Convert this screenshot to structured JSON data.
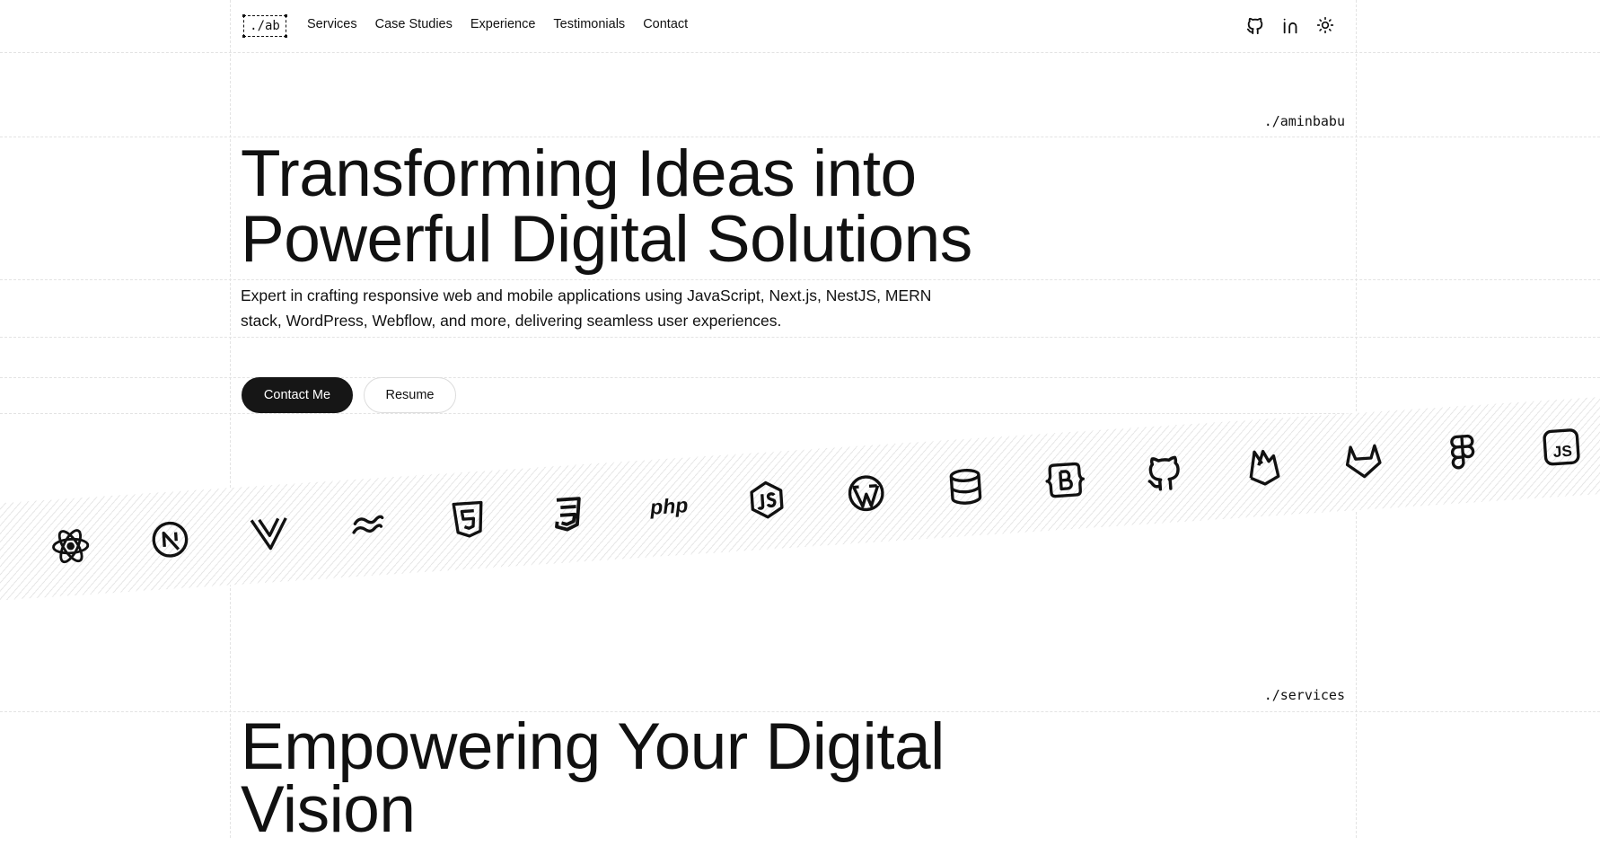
{
  "header": {
    "logo": "./ab",
    "nav": [
      {
        "label": "Services"
      },
      {
        "label": "Case Studies"
      },
      {
        "label": "Experience"
      },
      {
        "label": "Testimonials"
      },
      {
        "label": "Contact"
      }
    ],
    "icons": [
      "github-icon",
      "linkedin-icon",
      "sun-icon"
    ]
  },
  "hero": {
    "path": "./aminbabu",
    "title_line1": "Transforming Ideas into",
    "title_line2": "Powerful Digital Solutions",
    "subtitle": "Expert in crafting responsive web and mobile applications using JavaScript, Next.js, NestJS, MERN stack, WordPress, Webflow, and more, delivering seamless user experiences.",
    "primary_button": "Contact Me",
    "secondary_button": "Resume"
  },
  "tech_stack": {
    "icons": [
      "react-icon",
      "nextjs-icon",
      "vue-icon",
      "tailwind-icon",
      "html5-icon",
      "css3-icon",
      "php-icon",
      "nodejs-icon",
      "wordpress-icon",
      "database-icon",
      "bootstrap-icon",
      "github-icon",
      "firebase-icon",
      "gitlab-icon",
      "figma-icon",
      "javascript-icon"
    ],
    "php_text": "php",
    "js_text": "JS"
  },
  "services": {
    "path": "./services",
    "title_line1": "Empowering Your Digital",
    "title_line2": "Vision"
  },
  "colors": {
    "background": "#ffffff",
    "text": "#111111",
    "primary_button_bg": "#161616",
    "grid_line": "#e3e3e3"
  }
}
